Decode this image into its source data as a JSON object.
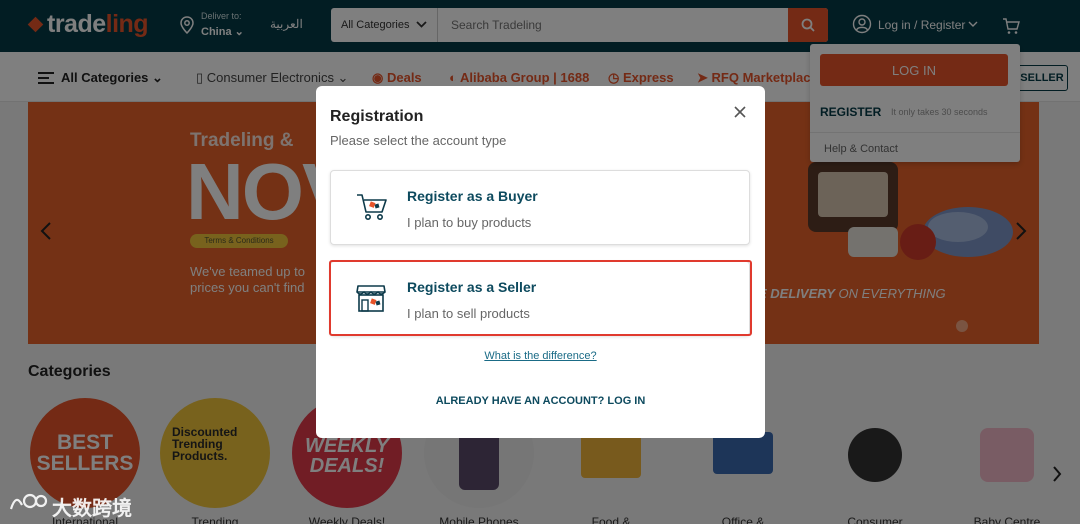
{
  "header": {
    "logo_prefix": "trade",
    "logo_suffix": "ling",
    "deliver_to_label": "Deliver to:",
    "deliver_to_value": "China",
    "language_toggle": "العربية",
    "category_select": "All Categories",
    "search_placeholder": "Search Tradeling",
    "account_label": "Log in / Register"
  },
  "nav": {
    "all_categories": "All Categories",
    "consumer_electronics": "Consumer Electronics",
    "deals": "Deals",
    "alibaba": "Alibaba Group | 1688",
    "express": "Express",
    "rfq": "RFQ Marketplace",
    "seller_button": "SELLER"
  },
  "banner": {
    "headline": "Tradeling &",
    "big_text": "NOV",
    "terms": "Terms & Conditions",
    "para_line1": "We've teamed up to",
    "para_line2": "prices you can't find",
    "delivery_bold": "E DELIVERY",
    "delivery_rest": "ON EVERYTHING"
  },
  "categories": {
    "title": "Categories",
    "items": [
      {
        "label": "International",
        "circle_text": "BEST SELLERS"
      },
      {
        "label": "Trending",
        "circle_text": "Discounted Trending Products."
      },
      {
        "label": "Weekly Deals!",
        "circle_text": "WEEKLY DEALS!"
      },
      {
        "label": "Mobile Phones",
        "circle_text": ""
      },
      {
        "label": "Food &",
        "circle_text": ""
      },
      {
        "label": "Office &",
        "circle_text": ""
      },
      {
        "label": "Consumer",
        "circle_text": ""
      },
      {
        "label": "Baby Centre",
        "circle_text": ""
      }
    ]
  },
  "dropdown": {
    "login": "LOG IN",
    "register": "REGISTER",
    "register_note": "It only takes 30 seconds",
    "help": "Help & Contact"
  },
  "modal": {
    "title": "Registration",
    "subtitle": "Please select the account type",
    "buyer_title": "Register as a Buyer",
    "buyer_desc": "I plan to buy products",
    "seller_title": "Register as a Seller",
    "seller_desc": "I plan to sell products",
    "difference_link": "What is the difference?",
    "login_link": "ALREADY HAVE AN ACCOUNT? LOG IN"
  },
  "watermark": {
    "text": "大数跨境"
  },
  "colors": {
    "header_bg": "#053b47",
    "accent": "#e8542a",
    "highlight_border": "#e03a2e",
    "link": "#1a6b86"
  }
}
